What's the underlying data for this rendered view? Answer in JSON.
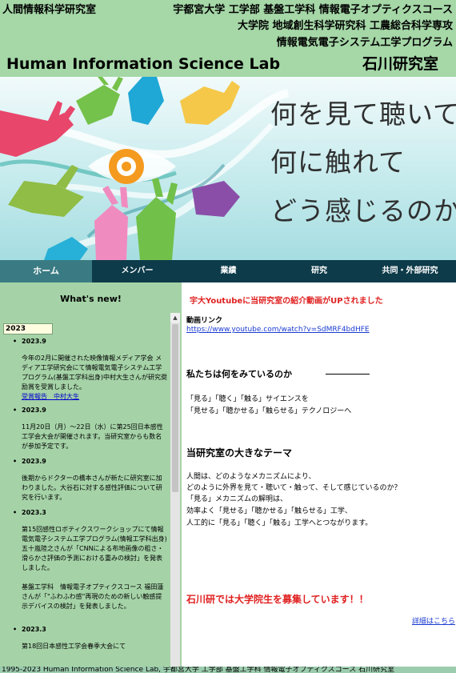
{
  "header": {
    "lab_name_jp": "人間情報科学研究室",
    "univ_line1": "宇都宮大学 工学部 基盤工学科 情報電子オプティクスコース",
    "univ_line2": "大学院 地域創生科学研究科 工農総合科学専攻",
    "univ_line3": "情報電気電子システム工学プログラム",
    "lab_name_en": "Human Information Science Lab",
    "lab_head": "石川研究室"
  },
  "hero": {
    "tagline": [
      "何を見て聴いて",
      "何に触れて",
      "どう感じるのか"
    ]
  },
  "nav": {
    "items": [
      "ホーム",
      "メンバー",
      "業績",
      "研究",
      "共同・外部研究"
    ],
    "active": "ホーム"
  },
  "sidebar": {
    "title": "What's new!",
    "year_selected": "2023",
    "news": [
      {
        "date": "2023.9",
        "body": "今年の2月に開催された映像情報メディア学会 メディア工学研究会にて情報電気電子システム工学プログラム(基盤工学科出身)中村大生さんが研究奨励賞を受賞しました。",
        "link": "受賞報告　中村大生"
      },
      {
        "date": "2023.9",
        "body": "11月20日（月）～22日（水）に第25回日本感性工学会大会が開催されます。当研究室からも数名が参加予定です。",
        "link": ""
      },
      {
        "date": "2023.9",
        "body": "後期からドクターの橋本さんが新たに研究室に加わりました。大谷石に対する感性評価について研究を行います。",
        "link": ""
      },
      {
        "date": "2023.3",
        "body": "第15回感性ロボティクスワークショップにて情報電気電子システム工学プログラム(情報工学科出身)五十嵐陸之さんが「CNNによる布地画像の粗さ・滑らかさ評価の予測における重みの検討」を発表しました。\n\n基盤工学科　情報電子オプティクスコース 福田蓮さんが「\"ふわふわ感\"再現のための新しい触感提示デバイスの検討」を発表しました。",
        "link": ""
      },
      {
        "date": "2023.3",
        "body": "第18回日本感性工学会春季大会にて",
        "link": ""
      }
    ]
  },
  "main": {
    "announcement": "宇大Youtubeに当研究室の紹介動画がUPされました",
    "video_label": "動画リンク",
    "video_url": "https://www.youtube.com/watch?v=SdMRF4bdHFE",
    "section1_title": "私たちは何をみているのか",
    "section1_lines": [
      "「見る」「聴く」「触る」サイエンスを",
      "「見せる」「聴かせる」「触らせる」テクノロジーへ"
    ],
    "section2_title": "当研究室の大きなテーマ",
    "section2_lines": [
      "人間は、どのようなメカニズムにより、",
      "どのように外界を見て・聴いて・触って、そして感じているのか？",
      "「見る」メカニズムの解明は、",
      "効率よく「見せる」「聴かせる」「触らせる」工学、",
      "人工的に「見る」「聴く」「触る」工学へとつながります。"
    ],
    "recruit": "石川研では大学院生を募集しています！！",
    "details_link": "詳細はこちら"
  },
  "footer": {
    "text": "1995-2023 Human Information Science Lab, 宇都宮大学 工学部 基盤工学科 情報電子オプティクスコース 石川研究室"
  }
}
